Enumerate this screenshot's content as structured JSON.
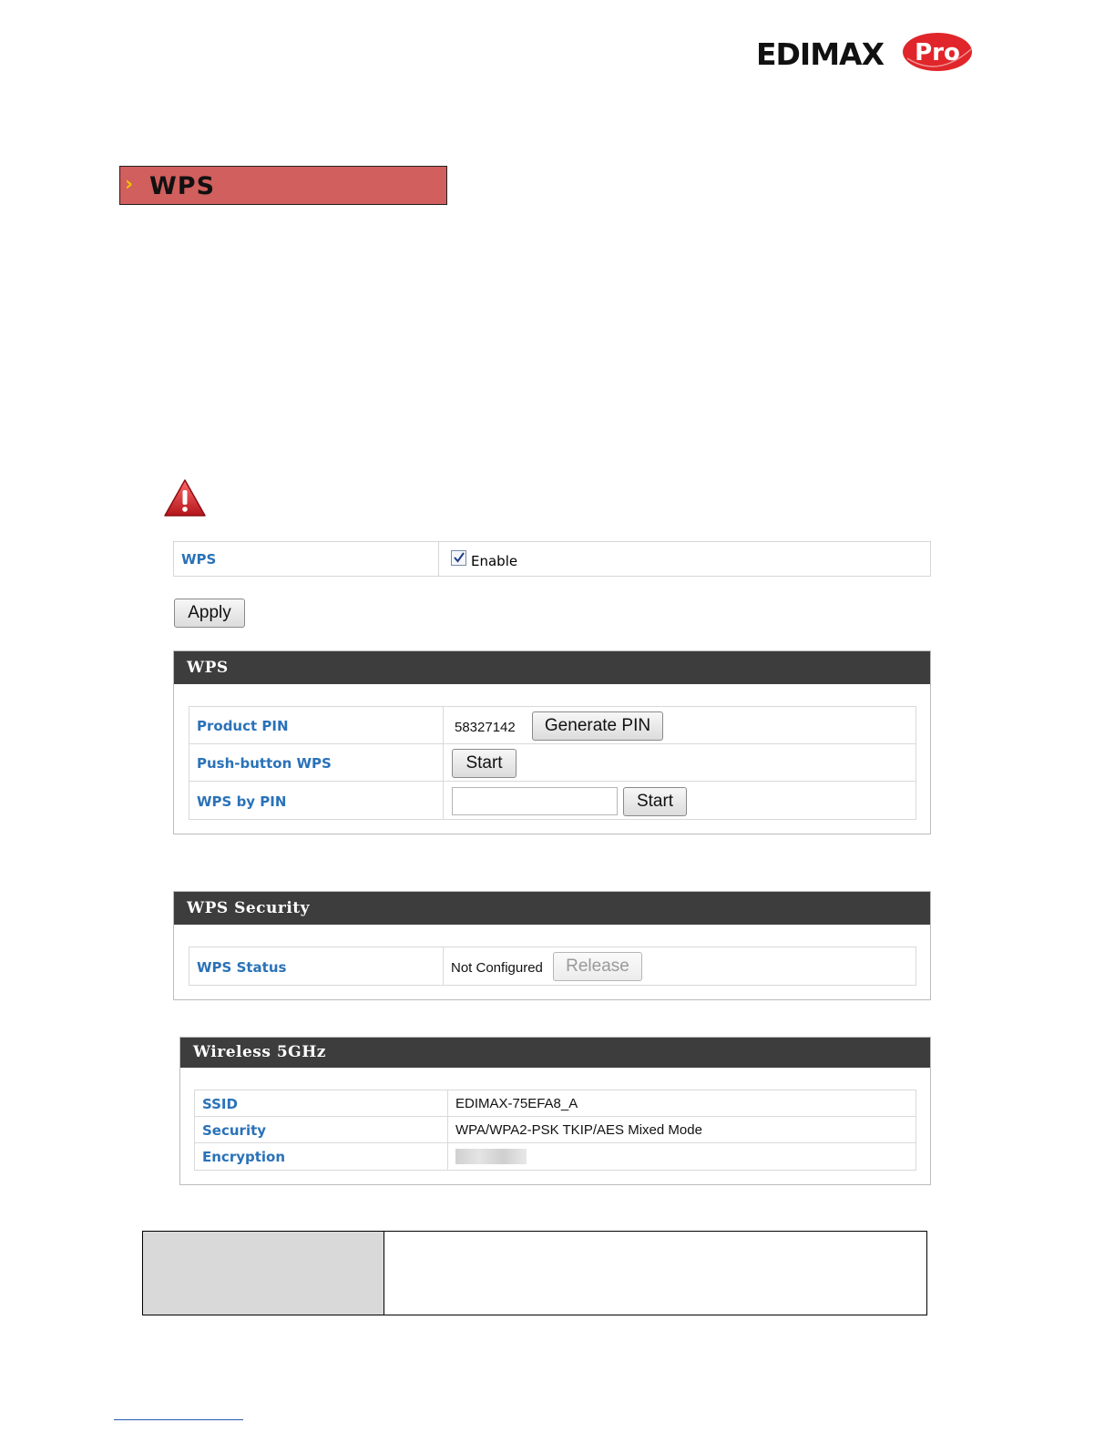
{
  "logo": {
    "brand": "EDIMAX",
    "pro": "Pro",
    "brand_color": "#111111",
    "pro_color": "#e0262a"
  },
  "section": {
    "title": "WPS",
    "bar_color": "#d05f5d"
  },
  "warning": {
    "icon": "warning-triangle-icon"
  },
  "enable_row": {
    "label": "WPS",
    "checkbox_checked": true,
    "checkbox_label": "Enable"
  },
  "apply_button": "Apply",
  "wps_panel": {
    "title": "WPS",
    "rows": [
      {
        "label": "Product PIN",
        "value": "58327142",
        "button": "Generate PIN"
      },
      {
        "label": "Push-button WPS",
        "button": "Start"
      },
      {
        "label": "WPS by PIN",
        "input_value": "",
        "button": "Start"
      }
    ]
  },
  "security_panel": {
    "title": "WPS Security",
    "rows": [
      {
        "label": "WPS Status",
        "value": "Not Configured",
        "button": "Release"
      }
    ]
  },
  "wireless_panel": {
    "title": "Wireless 5GHz",
    "rows": [
      {
        "label": "SSID",
        "value": "EDIMAX-75EFA8_A"
      },
      {
        "label": "Security",
        "value": "WPA/WPA2-PSK TKIP/AES Mixed Mode"
      },
      {
        "label": "Encryption",
        "value": ""
      }
    ]
  }
}
